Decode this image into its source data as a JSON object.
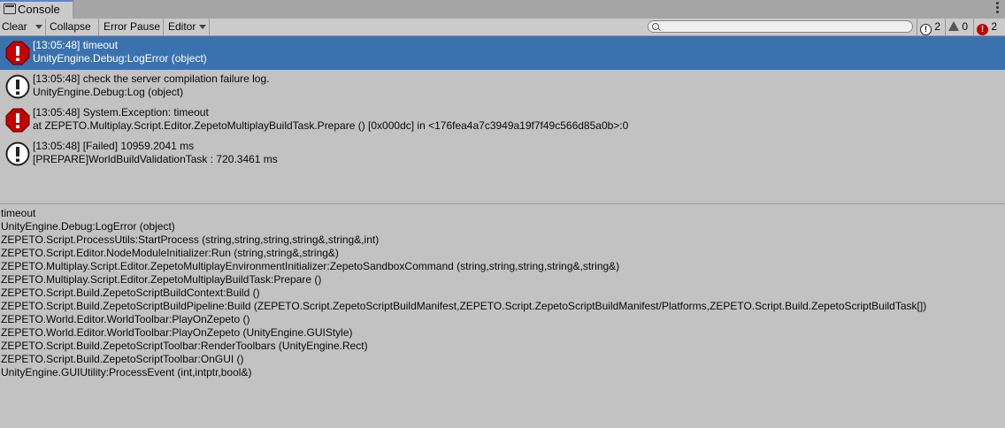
{
  "tab": {
    "title": "Console",
    "icon": "console-icon"
  },
  "toolbar": {
    "clear": "Clear",
    "collapse": "Collapse",
    "error_pause": "Error Pause",
    "editor": "Editor",
    "search": {
      "value": "",
      "placeholder": ""
    },
    "counters": {
      "info": "2",
      "warnings": "0",
      "errors": "2"
    }
  },
  "entries": [
    {
      "type": "error",
      "icon": "error-icon",
      "line1": "[13:05:48] timeout",
      "line2": "UnityEngine.Debug:LogError (object)",
      "selected": true
    },
    {
      "type": "info",
      "icon": "info-icon",
      "line1": "[13:05:48] check the server compilation failure log.",
      "line2": "UnityEngine.Debug:Log (object)",
      "selected": false
    },
    {
      "type": "error",
      "icon": "error-icon",
      "line1": "[13:05:48] System.Exception: timeout",
      "line2": "  at ZEPETO.Multiplay.Script.Editor.ZepetoMultiplayBuildTask.Prepare () [0x000dc] in <176fea4a7c3949a19f7f49c566d85a0b>:0",
      "selected": false
    },
    {
      "type": "info",
      "icon": "info-icon",
      "line1": "[13:05:48] [Failed] 10959.2041 ms",
      "line2": "[PREPARE]WorldBuildValidationTask : 720.3461 ms",
      "selected": false
    }
  ],
  "stack_trace": [
    "timeout",
    "UnityEngine.Debug:LogError (object)",
    "ZEPETO.Script.ProcessUtils:StartProcess (string,string,string,string&,string&,int)",
    "ZEPETO.Script.Editor.NodeModuleInitializer:Run (string,string&,string&)",
    "ZEPETO.Multiplay.Script.Editor.ZepetoMultiplayEnvironmentInitializer:ZepetoSandboxCommand (string,string,string,string&,string&)",
    "ZEPETO.Multiplay.Script.Editor.ZepetoMultiplayBuildTask:Prepare ()",
    "ZEPETO.Script.Build.ZepetoScriptBuildContext:Build ()",
    "ZEPETO.Script.Build.ZepetoScriptBuildPipeline:Build (ZEPETO.Script.ZepetoScriptBuildManifest,ZEPETO.Script.ZepetoScriptBuildManifest/Platforms,ZEPETO.Script.Build.ZepetoScriptBuildTask[])",
    "ZEPETO.World.Editor.WorldToolbar:PlayOnZepeto ()",
    "ZEPETO.World.Editor.WorldToolbar:PlayOnZepeto (UnityEngine.GUIStyle)",
    "ZEPETO.Script.Build.ZepetoScriptToolbar:RenderToolbars (UnityEngine.Rect)",
    "ZEPETO.Script.Build.ZepetoScriptToolbar:OnGUI ()",
    "UnityEngine.GUIUtility:ProcessEvent (int,intptr,bool&)"
  ],
  "colors": {
    "selected_row": "#3a72b0",
    "error": "#c40000",
    "background": "#c2c2c2"
  }
}
